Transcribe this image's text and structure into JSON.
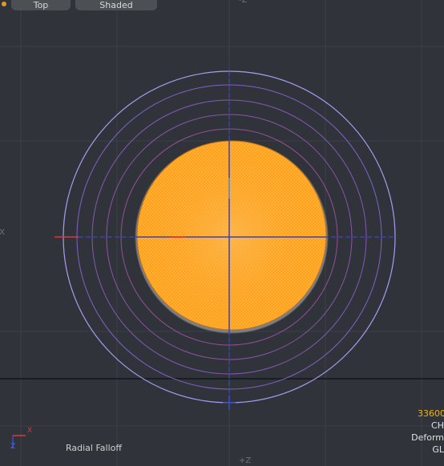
{
  "toolbar": {
    "view_label": "Top",
    "shading_label": "Shaded"
  },
  "axes": {
    "top_label": "-Z",
    "bottom_label": "+Z",
    "left_label": "-X",
    "gizmo_x": "X",
    "gizmo_z": "Z"
  },
  "tool_label": "Radial Falloff",
  "status": {
    "poly_count": "33600",
    "line2": "CH",
    "line3": "Deform",
    "line4": "GL"
  },
  "colors": {
    "background": "#30343a",
    "grid": "#3b4046",
    "mesh": "#ffa726",
    "falloff_ring": "#9a8cf0",
    "axis_blue": "#3b4bd8",
    "axis_red": "#d83a3a",
    "status_count": "#f5b400"
  }
}
